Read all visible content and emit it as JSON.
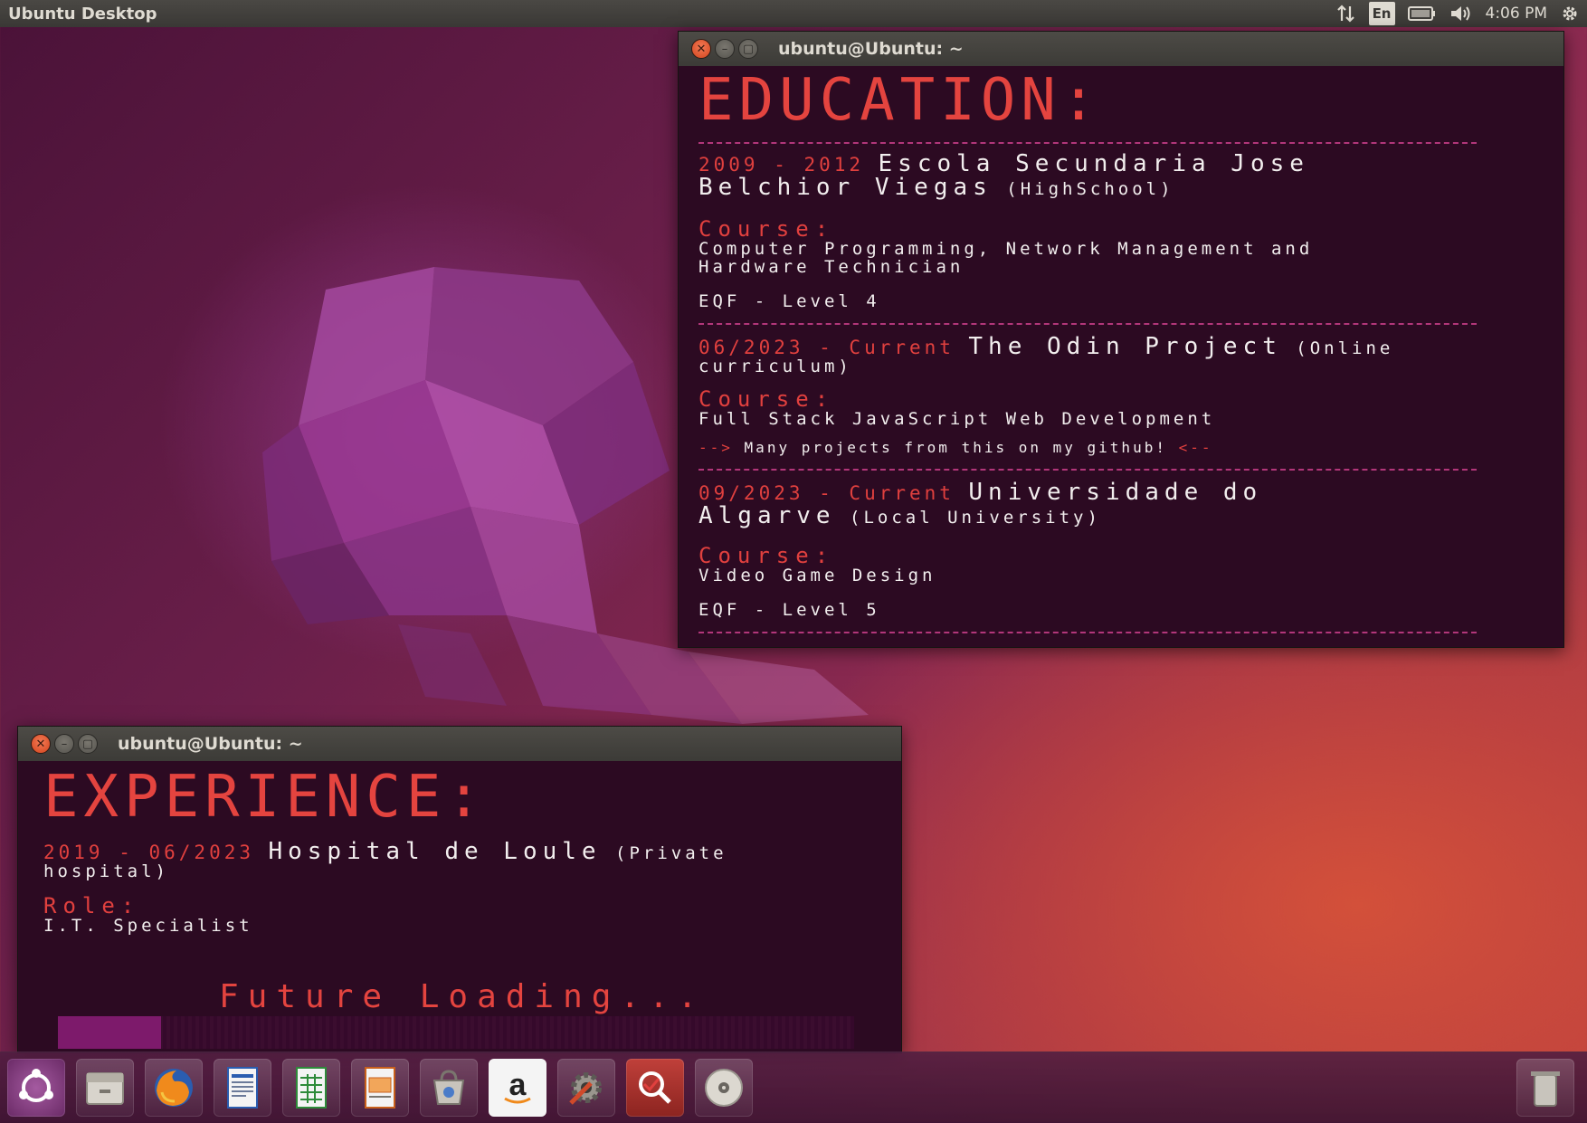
{
  "top_panel": {
    "title": "Ubuntu Desktop",
    "lang": "En",
    "clock": "4:06 PM",
    "icons": [
      "network-arrows-icon",
      "keyboard-layout-icon",
      "battery-icon",
      "volume-icon",
      "gear-icon"
    ]
  },
  "education_window": {
    "title": "ubuntu@Ubuntu: ~",
    "heading": "EDUCATION:",
    "entries": [
      {
        "date": "2009 - 2012",
        "institution": "Escola Secundaria Jose",
        "institution_cont": "Belchior Viegas",
        "institution_note": "(HighSchool)",
        "course_label": "Course:",
        "course_line1": "Computer Programming, Network Management and",
        "course_line2": "Hardware Technician",
        "level": "EQF - Level 4"
      },
      {
        "date": "06/2023 - Current",
        "institution": "The Odin Project",
        "institution_note": "(Online",
        "institution_note_cont": "curriculum)",
        "course_label": "Course:",
        "course_line1": "Full Stack JavaScript Web Development",
        "note_prefix": "-->",
        "note_text": "Many projects from this on my github!",
        "note_suffix": "<--"
      },
      {
        "date": "09/2023 - Current",
        "institution": "Universidade do",
        "institution_cont": "Algarve",
        "institution_note": "(Local University)",
        "course_label": "Course:",
        "course_line1": "Video Game Design",
        "level": "EQF - Level 5"
      }
    ]
  },
  "experience_window": {
    "title": "ubuntu@Ubuntu: ~",
    "heading": "EXPERIENCE:",
    "entry": {
      "date": "2019 - 06/2023",
      "institution": "Hospital de Loule",
      "institution_note": "(Private",
      "institution_note_cont": "hospital)",
      "role_label": "Role:",
      "role": "I.T. Specialist"
    },
    "loading_text": "Future Loading...",
    "loading_progress": 0.13
  },
  "dock": {
    "icons": [
      "ubuntu-logo-icon",
      "files-icon",
      "firefox-icon",
      "writer-icon",
      "calc-icon",
      "impress-icon",
      "software-center-icon",
      "amazon-icon",
      "system-settings-icon",
      "search-app-icon",
      "disc-icon"
    ],
    "trash": "trash-icon"
  },
  "colors": {
    "terminal_bg": "#2c0a22",
    "heading_red": "#e4443f",
    "separator": "#b2367a",
    "progress_fill": "#7d1a6b"
  }
}
